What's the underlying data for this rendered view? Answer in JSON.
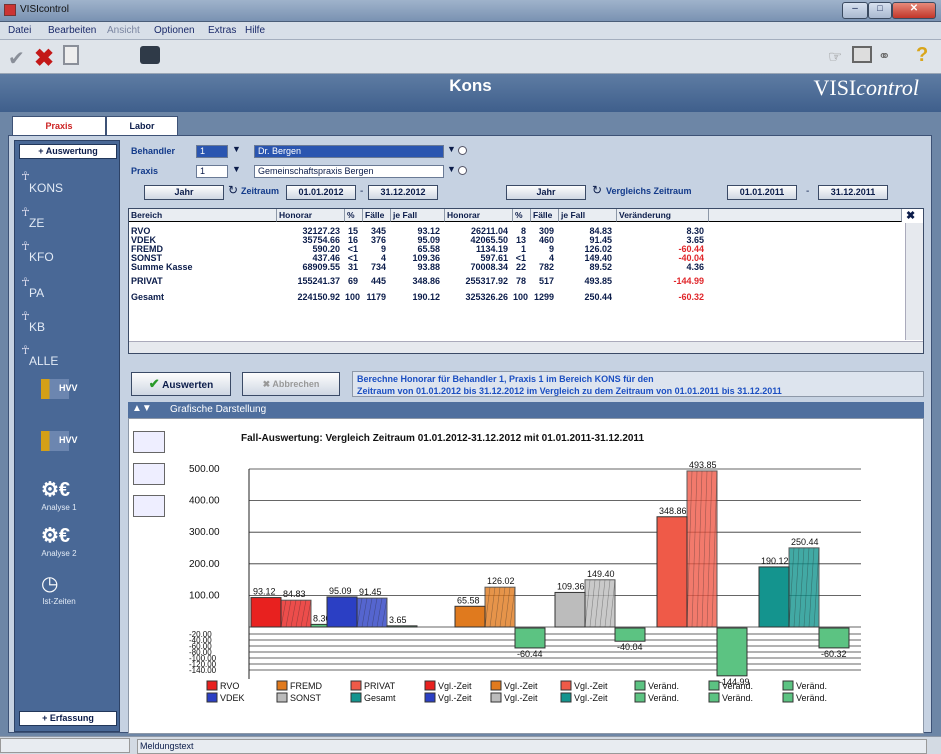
{
  "window": {
    "title": "VISIcontrol"
  },
  "menu": [
    "Datei",
    "Bearbeiten",
    "Ansicht",
    "Optionen",
    "Extras",
    "Hilfe"
  ],
  "header": {
    "title": "Kons",
    "brand_prefix": "VISI",
    "brand_suffix": "control"
  },
  "tabs": [
    "Praxis",
    "Labor"
  ],
  "sidebar": {
    "top_button": "+ Auswertung",
    "items": [
      "KONS",
      "ZE",
      "KFO",
      "PA",
      "KB",
      "ALLE"
    ],
    "extra": [
      "HVV",
      "HVV",
      "Analyse 1",
      "Analyse 2",
      "Ist-Zeiten"
    ],
    "bottom_button": "+ Erfassung"
  },
  "filters": {
    "behandler_label": "Behandler",
    "behandler_num": "1",
    "behandler_name": "Dr. Bergen",
    "praxis_label": "Praxis",
    "praxis_num": "1",
    "praxis_name": "Gemeinschaftspraxis Bergen",
    "jahr": "Jahr",
    "zeitraum": "Zeitraum",
    "from": "01.01.2012",
    "to": "31.12.2012",
    "jahr2": "Jahr",
    "vgl_zeitraum": "Vergleichs Zeitraum",
    "vfrom": "01.01.2011",
    "vto": "31.12.2011"
  },
  "table": {
    "headers": [
      "Bereich",
      "Honorar",
      "%",
      "Fälle",
      "je Fall",
      "Honorar",
      "%",
      "Fälle",
      "je Fall",
      "Veränderung"
    ],
    "rows": [
      [
        "RVO",
        "32127.23",
        "15",
        "345",
        "93.12",
        "26211.04",
        "8",
        "309",
        "84.83",
        "8.30"
      ],
      [
        "VDEK",
        "35754.66",
        "16",
        "376",
        "95.09",
        "42065.50",
        "13",
        "460",
        "91.45",
        "3.65"
      ],
      [
        "FREMD",
        "590.20",
        "<1",
        "9",
        "65.58",
        "1134.19",
        "1",
        "9",
        "126.02",
        "-60.44"
      ],
      [
        "SONST",
        "437.46",
        "<1",
        "4",
        "109.36",
        "597.61",
        "<1",
        "4",
        "149.40",
        "-40.04"
      ],
      [
        "Summe Kasse",
        "68909.55",
        "31",
        "734",
        "93.88",
        "70008.34",
        "22",
        "782",
        "89.52",
        "4.36"
      ],
      [
        "PRIVAT",
        "155241.37",
        "69",
        "445",
        "348.86",
        "255317.92",
        "78",
        "517",
        "493.85",
        "-144.99"
      ],
      [
        "Gesamt",
        "224150.92",
        "100",
        "1179",
        "190.12",
        "325326.26",
        "100",
        "1299",
        "250.44",
        "-60.32"
      ]
    ]
  },
  "actions": {
    "run": "Auswerten",
    "cancel": "Abbrechen",
    "message1": "Berechne Honorar für Behandler 1, Praxis 1 im Bereich KONS für den",
    "message2": "Zeitraum von 01.01.2012 bis 31.12.2012 im Vergleich zu dem Zeitraum von 01.01.2011 bis 31.12.2011"
  },
  "graph_section": "Grafische Darstellung",
  "status": {
    "text": "Meldungstext"
  },
  "colors": {
    "RVO": "#e8211f",
    "VDEK": "#2b3fc4",
    "FREMD": "#e07a1e",
    "SONST": "#bcbcbc",
    "PRIVAT": "#ef5a48",
    "Gesamt": "#14948e",
    "diff": "#5cc382"
  },
  "chart_data": {
    "type": "bar",
    "title": "Fall-Auswertung: Vergleich Zeitraum 01.01.2012-31.12.2012 mit 01.01.2011-31.12.2011",
    "ylim": [
      -150,
      500
    ],
    "yticks": [
      "500.00",
      "400.00",
      "300.00",
      "200.00",
      "100.00",
      "-20.00",
      "-40.00",
      "-60.00",
      "-80.00",
      "-100.00",
      "-120.00",
      "-140.00"
    ],
    "groups": [
      {
        "name": "RVO",
        "current": 93.12,
        "previous": 84.83,
        "change": 8.3
      },
      {
        "name": "VDEK",
        "current": 95.09,
        "previous": 91.45,
        "change": 3.65
      },
      {
        "name": "FREMD",
        "current": 65.58,
        "previous": 126.02,
        "change": -60.44
      },
      {
        "name": "SONST",
        "current": 109.36,
        "previous": 149.4,
        "change": -40.04
      },
      {
        "name": "PRIVAT",
        "current": 348.86,
        "previous": 493.85,
        "change": -144.99
      },
      {
        "name": "Gesamt",
        "current": 190.12,
        "previous": 250.44,
        "change": -60.32
      }
    ],
    "labels": {
      "RVO": [
        "93.12",
        "84.83",
        "8.30"
      ],
      "VDEK": [
        "95.09",
        "91.45",
        "3.65"
      ],
      "FREMD": [
        "65.58",
        "126.02",
        "-60.44"
      ],
      "SONST": [
        "109.36",
        "149.40",
        "-40.04"
      ],
      "PRIVAT": [
        "348.86",
        "493.85",
        "-144.99"
      ],
      "Gesamt": [
        "190.12",
        "250.44",
        "-60.32"
      ]
    },
    "legend": [
      "RVO",
      "VDEK",
      "FREMD",
      "SONST",
      "PRIVAT",
      "Gesamt",
      "Vgl.-Zeit",
      "Vgl.-Zeit",
      "Vgl.-Zeit",
      "Vgl.-Zeit",
      "Vgl.-Zeit",
      "Vgl.-Zeit",
      "Veränd.",
      "Veränd.",
      "Veränd.",
      "Veränd.",
      "Veränd.",
      "Veränd."
    ]
  }
}
